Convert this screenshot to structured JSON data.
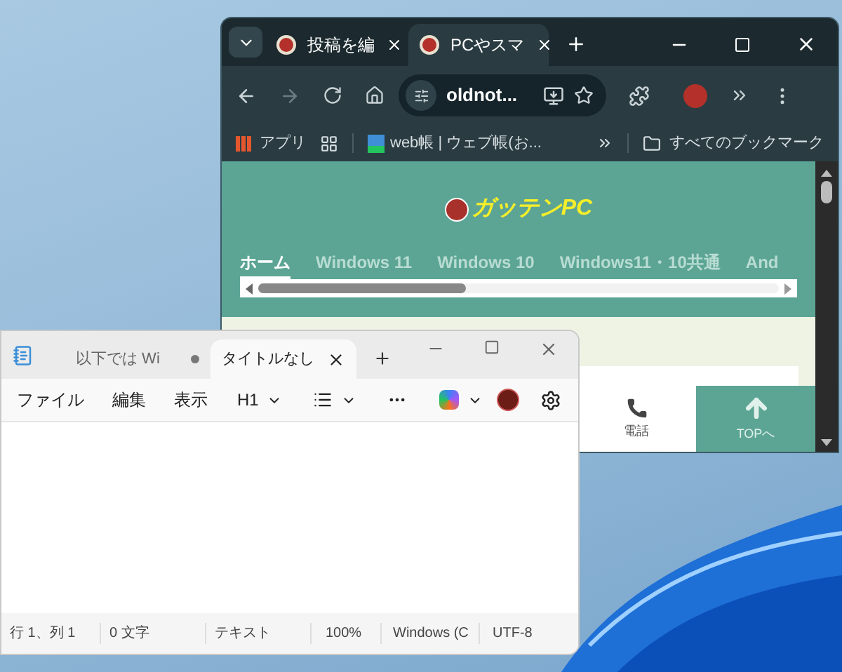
{
  "browser": {
    "tabs": [
      {
        "title": "投稿を編",
        "selected": false
      },
      {
        "title": "PCやスマ",
        "selected": true
      }
    ],
    "address": "oldnot...",
    "bookmarks": [
      {
        "label": "アプリ",
        "kind": "apps"
      },
      {
        "label": "web帳 | ウェブ帳(お...",
        "kind": "site"
      }
    ],
    "all_bookmarks": "すべてのブックマーク",
    "page": {
      "logo": "ガッテンPC",
      "nav": [
        {
          "label": "ホーム",
          "selected": true
        },
        {
          "label": "Windows 11",
          "selected": false
        },
        {
          "label": "Windows 10",
          "selected": false
        },
        {
          "label": "Windows11・10共通",
          "selected": false
        },
        {
          "label": "And",
          "selected": false
        }
      ],
      "scrollbar": {
        "level": 0.4
      },
      "footer_buttons": [
        {
          "label": "電話",
          "kind": "phone"
        },
        {
          "label": "TOPへ",
          "kind": "top"
        }
      ]
    }
  },
  "notepad": {
    "tabs": [
      {
        "title": "以下では Wi",
        "selected": false,
        "unsaved": true
      },
      {
        "title": "タイトルなし",
        "selected": true,
        "unsaved": false
      }
    ],
    "menu": [
      "ファイル",
      "編集",
      "表示"
    ],
    "heading": "H1",
    "status": [
      "行 1、列 1",
      "0 文字",
      "テキスト",
      "100%",
      "Windows (C",
      "UTF-8"
    ]
  }
}
